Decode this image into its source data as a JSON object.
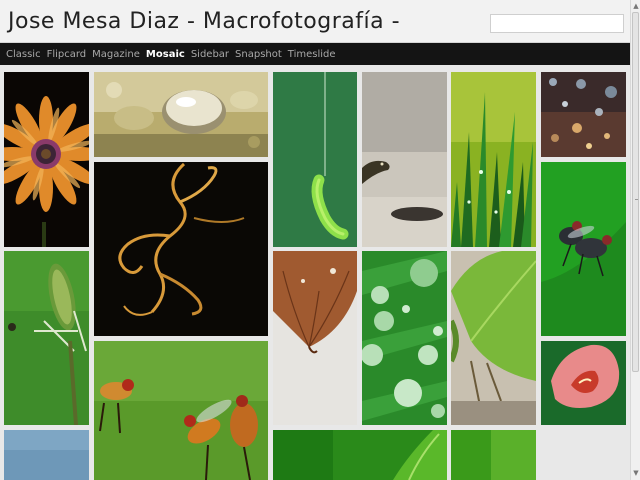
{
  "header": {
    "title": "Jose Mesa Diaz - Macrofotografía -",
    "search_value": ""
  },
  "nav": {
    "items": [
      {
        "label": "Classic",
        "active": false
      },
      {
        "label": "Flipcard",
        "active": false
      },
      {
        "label": "Magazine",
        "active": false
      },
      {
        "label": "Mosaic",
        "active": true
      },
      {
        "label": "Sidebar",
        "active": false
      },
      {
        "label": "Snapshot",
        "active": false
      },
      {
        "label": "Timeslide",
        "active": false
      }
    ]
  },
  "colors": {
    "header_bg": "#f2f2f2",
    "nav_bg": "#141414",
    "nav_active": "#ffffff",
    "nav_inactive": "#a8a8a8",
    "page_bg": "#e8e8e8"
  },
  "gallery": {
    "photos": [
      {
        "subject": "orange daisy flower",
        "icon": "flower-photo"
      },
      {
        "subject": "water drops",
        "icon": "water-drop-photo"
      },
      {
        "subject": "green caterpillar hanging",
        "icon": "caterpillar-photo"
      },
      {
        "subject": "lizard on rock",
        "icon": "lizard-photo"
      },
      {
        "subject": "grass with dew",
        "icon": "grass-photo"
      },
      {
        "subject": "bokeh droplets",
        "icon": "bokeh-photo"
      },
      {
        "subject": "curled plant tendril",
        "icon": "tendril-photo"
      },
      {
        "subject": "mating flies on leaf",
        "icon": "flies-photo"
      },
      {
        "subject": "fuzzy plant bud",
        "icon": "plant-bud-photo"
      },
      {
        "subject": "dry autumn leaf",
        "icon": "dry-leaf-photo"
      },
      {
        "subject": "raindrops on leaf",
        "icon": "raindrops-photo"
      },
      {
        "subject": "insect on green leaf",
        "icon": "leaf-insect-photo"
      },
      {
        "subject": "pink rose bud",
        "icon": "rose-photo"
      },
      {
        "subject": "hoverflies mating",
        "icon": "hoverflies-photo"
      },
      {
        "subject": "blue sky",
        "icon": "sky-photo"
      },
      {
        "subject": "green leaf blade",
        "icon": "leaf-blade-photo"
      },
      {
        "subject": "green bokeh",
        "icon": "green-bokeh-photo"
      }
    ]
  }
}
